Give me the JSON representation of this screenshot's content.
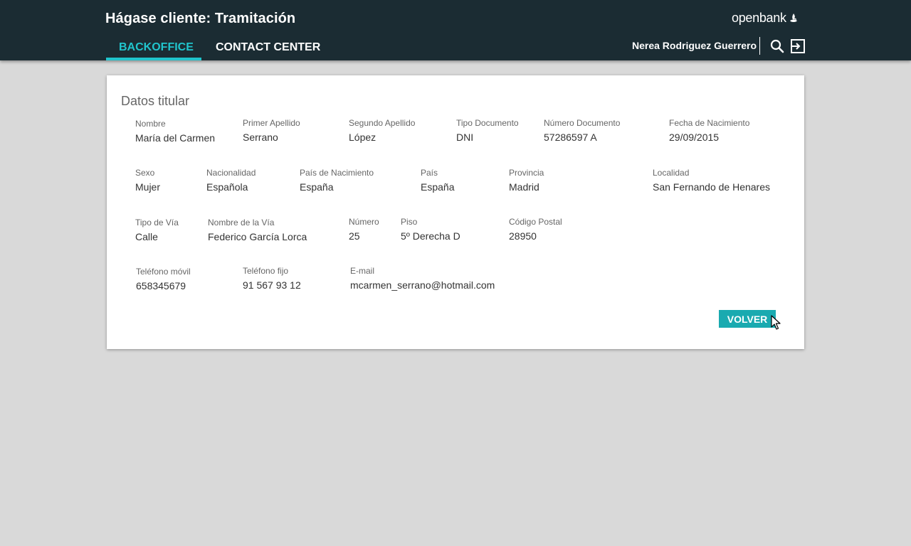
{
  "header": {
    "title": "Hágase cliente: Tramitación",
    "brand": "openbank",
    "brand_color": "#ffffff",
    "background_color": "#1b2c33",
    "tabs": [
      {
        "label": "BACKOFFICE",
        "active": true
      },
      {
        "label": "CONTACT CENTER",
        "active": false
      }
    ],
    "accent_color": "#21c4cc",
    "user_name": "Nerea Rodriguez Guerrero",
    "icons": [
      "search-icon",
      "logout-icon"
    ]
  },
  "card": {
    "title": "Datos titular",
    "fields": {
      "nombre": {
        "label": "Nombre",
        "value": "María del Carmen"
      },
      "primer_apellido": {
        "label": "Primer Apellido",
        "value": "Serrano"
      },
      "segundo_apellido": {
        "label": "Segundo Apellido",
        "value": "López"
      },
      "tipo_documento": {
        "label": "Tipo Documento",
        "value": "DNI"
      },
      "numero_documento": {
        "label": "Número Documento",
        "value": "57286597 A"
      },
      "fecha_nacimiento": {
        "label": "Fecha de Nacimiento",
        "value": "29/09/2015"
      },
      "sexo": {
        "label": "Sexo",
        "value": "Mujer"
      },
      "nacionalidad": {
        "label": "Nacionalidad",
        "value": "Española"
      },
      "pais_nacimiento": {
        "label": "País de Nacimiento",
        "value": "España"
      },
      "pais": {
        "label": "País",
        "value": "España"
      },
      "provincia": {
        "label": "Provincia",
        "value": "Madrid"
      },
      "localidad": {
        "label": "Localidad",
        "value": "San Fernando de Henares"
      },
      "tipo_via": {
        "label": "Tipo de Vía",
        "value": "Calle"
      },
      "nombre_via": {
        "label": "Nombre de la Vía",
        "value": "Federico García Lorca"
      },
      "numero": {
        "label": "Número",
        "value": "25"
      },
      "piso": {
        "label": "Piso",
        "value": "5º Derecha D"
      },
      "codigo_postal": {
        "label": "Código Postal",
        "value": "28950"
      },
      "telefono_movil": {
        "label": "Teléfono móvil",
        "value": "658345679"
      },
      "telefono_fijo": {
        "label": "Teléfono fijo",
        "value": "91 567 93 12"
      },
      "email": {
        "label": "E-mail",
        "value": "mcarmen_serrano@hotmail.com"
      }
    },
    "button_label": "VOLVER",
    "button_color": "#1aaab0"
  }
}
